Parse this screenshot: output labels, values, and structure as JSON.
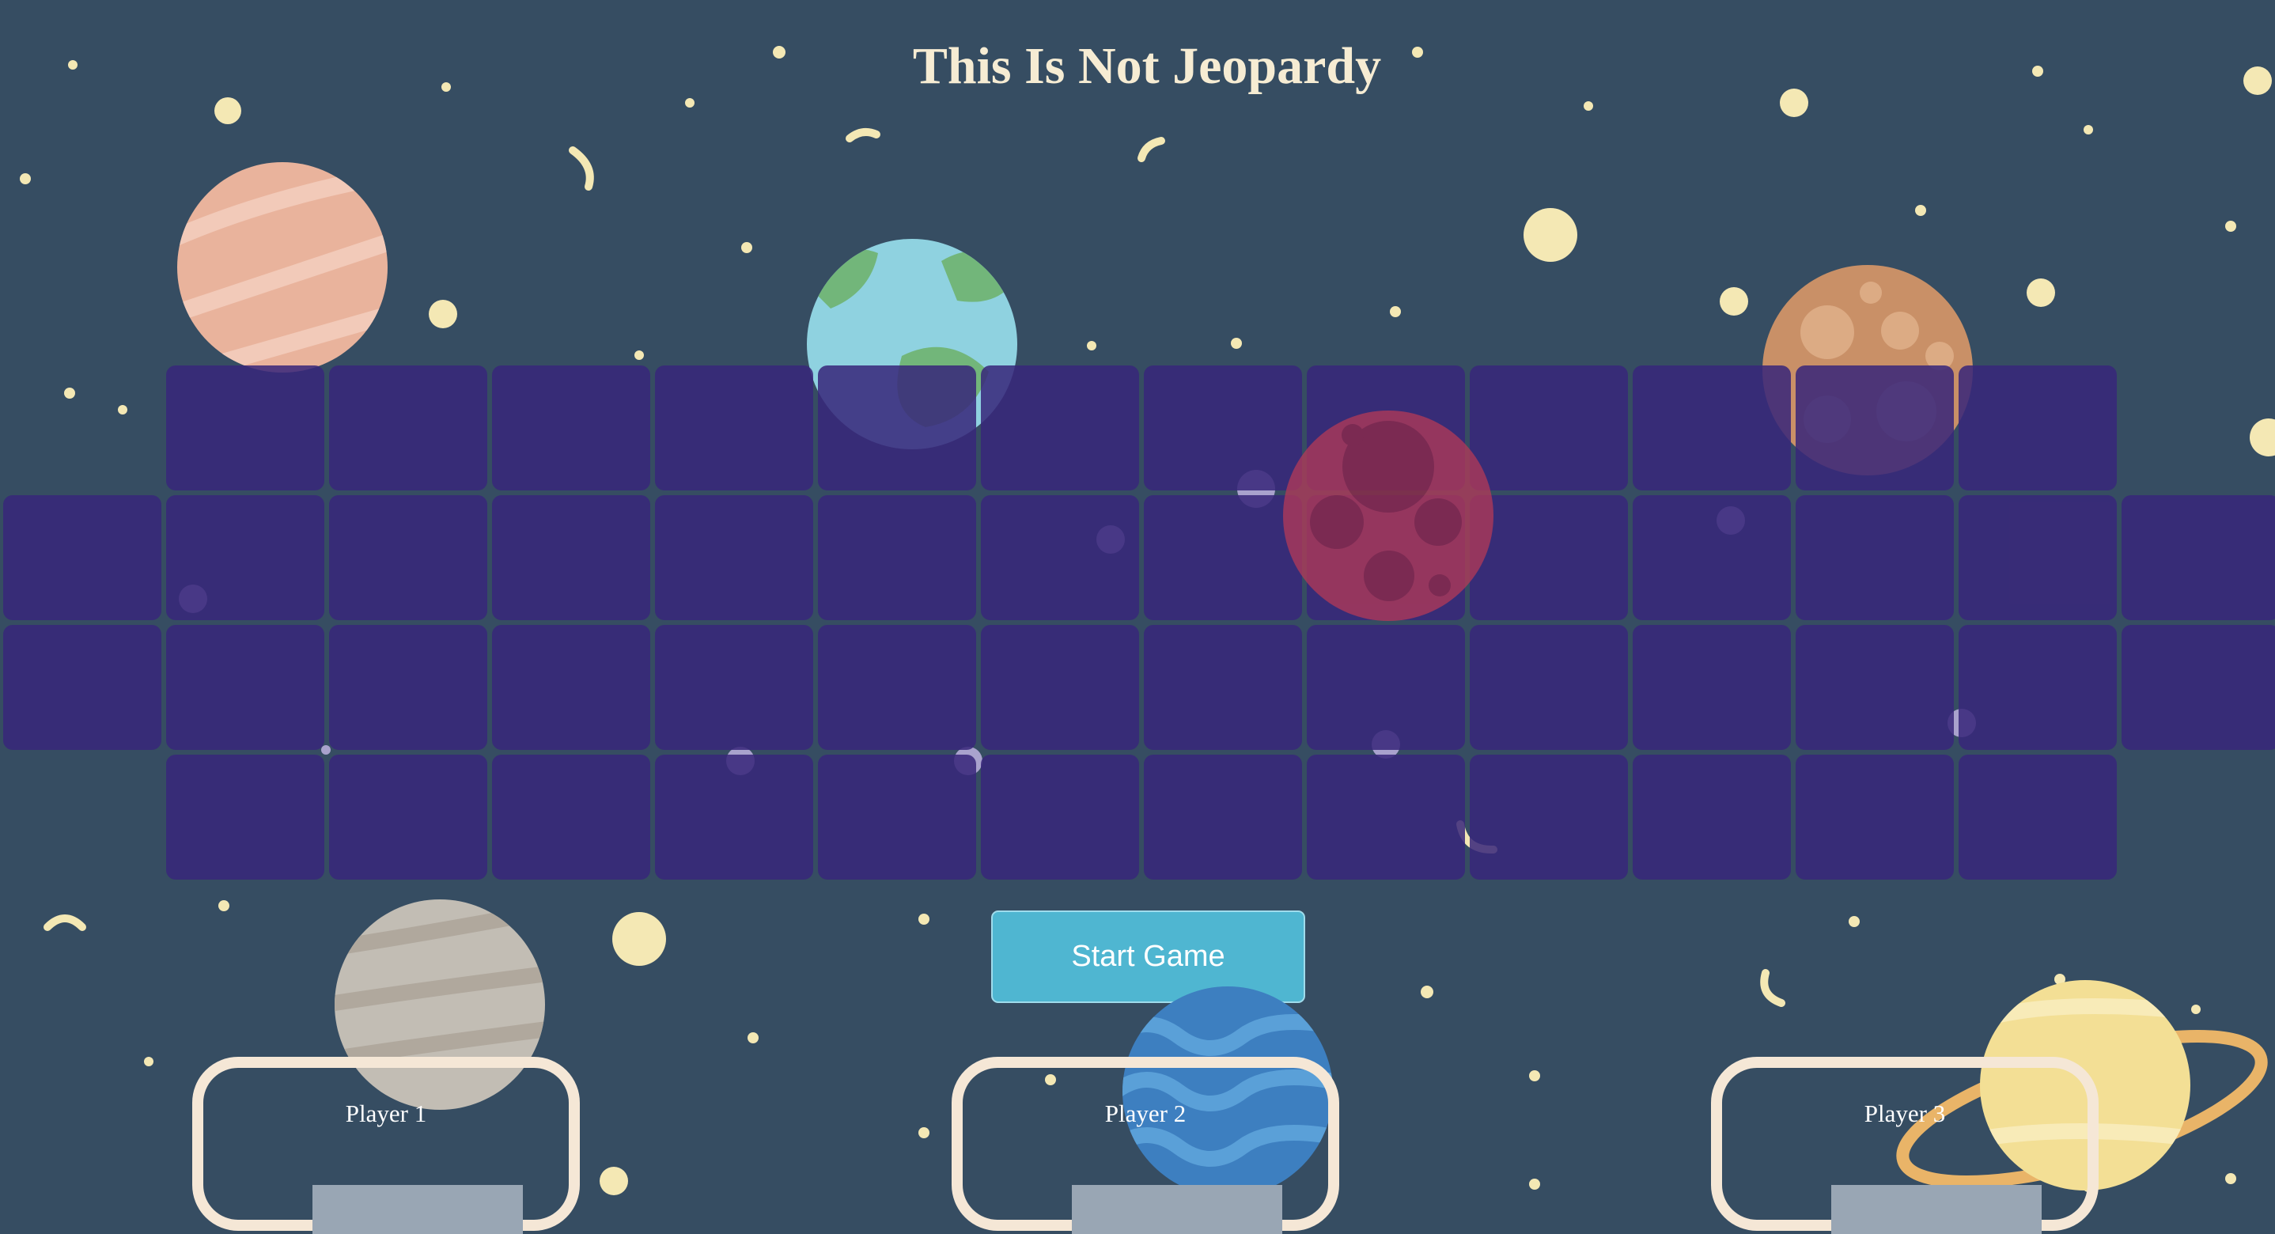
{
  "game": {
    "title": "This Is Not Jeopardy",
    "start_button_label": "Start Game"
  },
  "board": {
    "rows": [
      12,
      14,
      14,
      12
    ]
  },
  "players": [
    {
      "name": "Player 1",
      "score": ""
    },
    {
      "name": "Player 2",
      "score": ""
    },
    {
      "name": "Player 3",
      "score": ""
    }
  ],
  "background": {
    "color": "#364d62",
    "planets": [
      "pink-planet",
      "earth-planet",
      "red-cratered-planet",
      "orange-cratered-planet",
      "gray-planet",
      "blue-planet",
      "ringed-planet"
    ]
  }
}
